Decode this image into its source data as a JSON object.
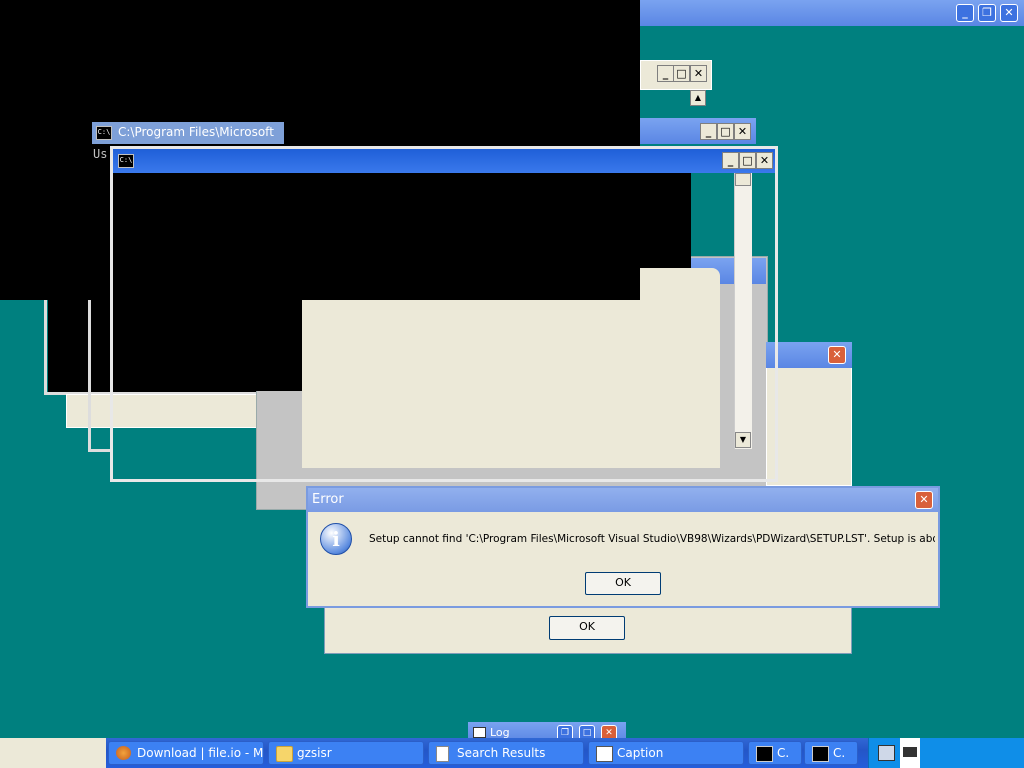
{
  "windows": {
    "cmd_partial": {
      "title": "C:\\Program Files\\Microsoft",
      "text": "Us"
    },
    "cmd_front": {
      "minimize": "_",
      "maximize": "□",
      "close": "✕"
    }
  },
  "error_dialog": {
    "title": "Error",
    "message": "Setup cannot find 'C:\\Program Files\\Microsoft Visual Studio\\VB98\\Wizards\\PDWizard\\SETUP.LST'.  Setup is aborting...",
    "ok_label": "OK"
  },
  "back_dialog": {
    "ok_label": "OK"
  },
  "bottom_window": {
    "title": "Log"
  },
  "taskbar": {
    "items": [
      {
        "label": "Download | file.io - M...",
        "icon": "firefox-icon"
      },
      {
        "label": "gzsisr",
        "icon": "folder-icon"
      },
      {
        "label": "Search Results",
        "icon": "search-results-icon"
      },
      {
        "label": "Caption",
        "icon": "window-icon"
      },
      {
        "label": "C.",
        "icon": "cmd-icon"
      },
      {
        "label": "C.",
        "icon": "cmd-icon"
      }
    ]
  }
}
